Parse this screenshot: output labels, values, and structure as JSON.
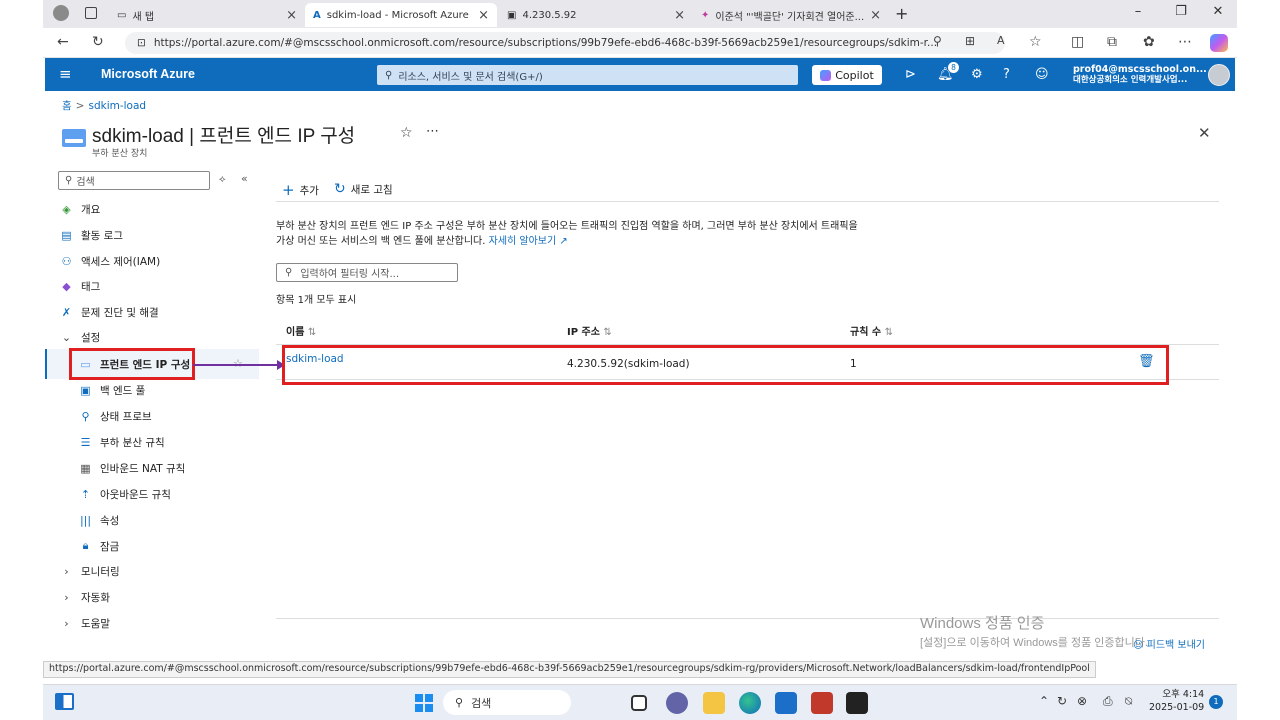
{
  "browser": {
    "tabs": [
      {
        "label": "새 탭"
      },
      {
        "label": "sdkim-load - Microsoft Azure"
      },
      {
        "label": "4.230.5.92"
      },
      {
        "label": "이준석 \"'백골단' 기자회견 열어준..."
      }
    ],
    "url": "https://portal.azure.com/#@mscsschool.onmicrosoft.com/resource/subscriptions/99b79efe-ebd6-468c-b39f-5669acb259e1/resourcegroups/sdkim-r...",
    "status_url": "https://portal.azure.com/#@mscsschool.onmicrosoft.com/resource/subscriptions/99b79efe-ebd6-468c-b39f-5669acb259e1/resourcegroups/sdkim-rg/providers/Microsoft.Network/loadBalancers/sdkim-load/frontendIpPool"
  },
  "azure": {
    "brand": "Microsoft Azure",
    "search_placeholder": "리소스, 서비스 및 문서 검색(G+/)",
    "copilot": "Copilot",
    "notif_count": "8",
    "account_email": "prof04@mscsschool.on...",
    "account_org": "대한상공회의소 인력개발사업..."
  },
  "breadcrumb": {
    "home": "홈",
    "current": "sdkim-load"
  },
  "page": {
    "title": "sdkim-load | 프런트 엔드 IP 구성",
    "subtitle": "부하 분산 장치"
  },
  "sidebar": {
    "search_placeholder": "검색",
    "items": [
      {
        "label": "개요"
      },
      {
        "label": "활동 로그"
      },
      {
        "label": "액세스 제어(IAM)"
      },
      {
        "label": "태그"
      },
      {
        "label": "문제 진단 및 해결"
      },
      {
        "label": "설정"
      },
      {
        "label": "프런트 엔드 IP 구성"
      },
      {
        "label": "백 엔드 풀"
      },
      {
        "label": "상태 프로브"
      },
      {
        "label": "부하 분산 규칙"
      },
      {
        "label": "인바운드 NAT 규칙"
      },
      {
        "label": "아웃바운드 규칙"
      },
      {
        "label": "속성"
      },
      {
        "label": "잠금"
      },
      {
        "label": "모니터링"
      },
      {
        "label": "자동화"
      },
      {
        "label": "도움말"
      }
    ]
  },
  "main": {
    "add": "추가",
    "refresh": "새로 고침",
    "desc_line1": "부하 분산 장치의 프런트 엔드 IP 주소 구성은 부하 분산 장치에 들어오는 트래픽의 진입점 역할을 하며, 그러면 부하 분산 장치에서 트래픽을",
    "desc_line2": "가상 머신 또는 서비스의 백 엔드 풀에 분산합니다.",
    "learn_more": "자세히 알아보기",
    "filter_placeholder": "입력하여 필터링 시작...",
    "count_text": "항목 1개 모두 표시",
    "columns": [
      "이름",
      "IP 주소",
      "규칙 수"
    ],
    "rows": [
      {
        "name": "sdkim-load",
        "ip": "4.230.5.92(sdkim-load)",
        "rules": "1"
      }
    ]
  },
  "windows": {
    "activate_title": "Windows 정품 인증",
    "activate_desc": "[설정]으로 이동하여 Windows를 정품 인증합니다.",
    "feedback": "피드백 보내기",
    "taskbar_search": "검색",
    "time": "오후 4:14",
    "date": "2025-01-09",
    "badge": "1"
  },
  "colors": {
    "azure_blue": "#0f6cbd",
    "highlight_red": "#e02020",
    "arrow_purple": "#7030a0"
  }
}
